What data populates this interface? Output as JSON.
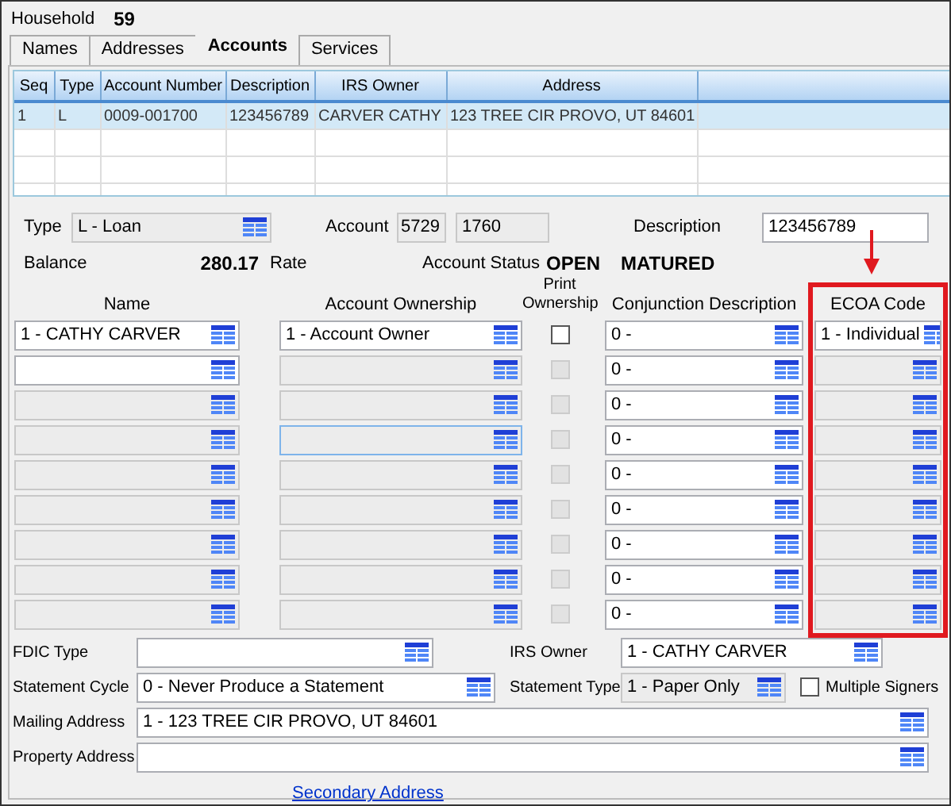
{
  "header": {
    "label": "Household",
    "value": "59"
  },
  "tabs": [
    {
      "label": "Names",
      "selected": false
    },
    {
      "label": "Addresses",
      "selected": false
    },
    {
      "label": "Accounts",
      "selected": true
    },
    {
      "label": "Services",
      "selected": false
    }
  ],
  "accounts_table": {
    "columns": [
      "Seq",
      "Type",
      "Account Number",
      "Description",
      "IRS Owner",
      "Address"
    ],
    "rows": [
      {
        "cells": [
          "1",
          "L",
          "0009-001700",
          "123456789",
          "CARVER CATHY",
          "123 TREE CIR PROVO, UT 84601"
        ],
        "selected": true
      }
    ]
  },
  "account": {
    "type": {
      "label": "Type",
      "value": "L - Loan",
      "disabled": true
    },
    "account": {
      "label": "Account",
      "parts": [
        {
          "value": "5729",
          "disabled": true
        },
        {
          "value": "1760",
          "disabled": true
        }
      ]
    },
    "description": {
      "label": "Description",
      "value": "123456789",
      "disabled": false
    },
    "balance": {
      "label": "Balance",
      "value": "280.17"
    },
    "rate": "Rate",
    "status": {
      "label": "Account Status",
      "values": [
        "OPEN",
        "MATURED"
      ]
    }
  },
  "owners": {
    "columns": [
      "Name",
      "Account Ownership",
      "Print Ownership",
      "Conjunction Description",
      "ECOA Code"
    ],
    "rows": [
      {
        "name": {
          "value": "1 - CATHY CARVER",
          "disabled": false
        },
        "ownership": {
          "value": "1 - Account Owner",
          "disabled": false,
          "focused": false
        },
        "print_ownership": {
          "checked": false,
          "disabled": false
        },
        "conjunction": {
          "value": "0 -",
          "disabled": false
        },
        "ecoa": {
          "value": "1 - Individual",
          "disabled": false
        }
      },
      {
        "name": {
          "disabled": false
        },
        "ownership": {
          "disabled": true,
          "focused": false
        },
        "print_ownership": {
          "checked": false,
          "disabled": true
        },
        "conjunction": {
          "value": "0 -",
          "disabled": false
        },
        "ecoa": {
          "disabled": true
        }
      },
      {
        "name": {
          "disabled": true
        },
        "ownership": {
          "disabled": true,
          "focused": false
        },
        "print_ownership": {
          "checked": false,
          "disabled": true
        },
        "conjunction": {
          "value": "0 -",
          "disabled": false
        },
        "ecoa": {
          "disabled": true
        }
      },
      {
        "name": {
          "disabled": true
        },
        "ownership": {
          "disabled": true,
          "focused": true
        },
        "print_ownership": {
          "checked": false,
          "disabled": true
        },
        "conjunction": {
          "value": "0 -",
          "disabled": false
        },
        "ecoa": {
          "disabled": true
        }
      },
      {
        "name": {
          "disabled": true
        },
        "ownership": {
          "disabled": true,
          "focused": false
        },
        "print_ownership": {
          "checked": false,
          "disabled": true
        },
        "conjunction": {
          "value": "0 -",
          "disabled": false
        },
        "ecoa": {
          "disabled": true
        }
      },
      {
        "name": {
          "disabled": true
        },
        "ownership": {
          "disabled": true,
          "focused": false
        },
        "print_ownership": {
          "checked": false,
          "disabled": true
        },
        "conjunction": {
          "value": "0 -",
          "disabled": false
        },
        "ecoa": {
          "disabled": true
        }
      },
      {
        "name": {
          "disabled": true
        },
        "ownership": {
          "disabled": true,
          "focused": false
        },
        "print_ownership": {
          "checked": false,
          "disabled": true
        },
        "conjunction": {
          "value": "0 -",
          "disabled": false
        },
        "ecoa": {
          "disabled": true
        }
      },
      {
        "name": {
          "disabled": true
        },
        "ownership": {
          "disabled": true,
          "focused": false
        },
        "print_ownership": {
          "checked": false,
          "disabled": true
        },
        "conjunction": {
          "value": "0 -",
          "disabled": false
        },
        "ecoa": {
          "disabled": true
        }
      },
      {
        "name": {
          "disabled": true
        },
        "ownership": {
          "disabled": true,
          "focused": false
        },
        "print_ownership": {
          "checked": false,
          "disabled": true
        },
        "conjunction": {
          "value": "0 -",
          "disabled": false
        },
        "ecoa": {
          "disabled": true
        }
      }
    ]
  },
  "details": {
    "fdic_type": {
      "label": "FDIC Type",
      "disabled": false
    },
    "irs_owner": {
      "label": "IRS Owner",
      "value": "1 - CATHY CARVER",
      "disabled": false
    },
    "statement_cycle": {
      "label": "Statement Cycle",
      "value": "0 - Never Produce a Statement",
      "disabled": false
    },
    "statement_type": {
      "label": "Statement Type",
      "value": "1 - Paper Only",
      "disabled": true
    },
    "multiple_signers": {
      "label": "Multiple Signers",
      "checked": false
    },
    "mailing_address": {
      "label": "Mailing Address",
      "value": "1 - 123 TREE CIR PROVO, UT 84601",
      "disabled": false
    },
    "property_address": {
      "label": "Property Address",
      "disabled": false
    }
  },
  "secondary_address_link": "Secondary Address"
}
